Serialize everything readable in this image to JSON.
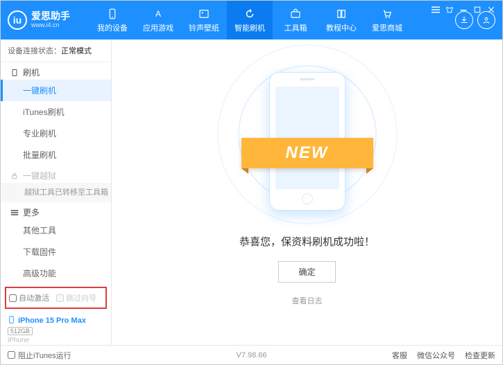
{
  "header": {
    "logo_badge": "iu",
    "app_name": "爱思助手",
    "app_url": "www.i4.cn",
    "nav": [
      {
        "label": "我的设备"
      },
      {
        "label": "应用游戏"
      },
      {
        "label": "铃声壁纸"
      },
      {
        "label": "智能刷机",
        "active": true
      },
      {
        "label": "工具箱"
      },
      {
        "label": "教程中心"
      },
      {
        "label": "爱思商城"
      }
    ]
  },
  "sidebar": {
    "conn_label": "设备连接状态：",
    "conn_value": "正常模式",
    "sec_flash": "刷机",
    "items_flash": [
      {
        "label": "一键刷机",
        "active": true
      },
      {
        "label": "iTunes刷机"
      },
      {
        "label": "专业刷机"
      },
      {
        "label": "批量刷机"
      }
    ],
    "sec_jailbreak": "一键越狱",
    "jailbreak_note": "越狱工具已转移至工具箱",
    "sec_more": "更多",
    "items_more": [
      {
        "label": "其他工具"
      },
      {
        "label": "下载固件"
      },
      {
        "label": "高级功能"
      }
    ],
    "opt_auto_activate": "自动激活",
    "opt_skip_guide": "跳过向导",
    "device_name": "iPhone 15 Pro Max",
    "device_capacity": "512GB",
    "device_model": "iPhone"
  },
  "main": {
    "ribbon_text": "NEW",
    "success_msg": "恭喜您，保资料刷机成功啦！",
    "ok_label": "确定",
    "view_log": "查看日志"
  },
  "statusbar": {
    "block_itunes": "阻止iTunes运行",
    "version": "V7.98.66",
    "links": [
      "客服",
      "微信公众号",
      "检查更新"
    ]
  }
}
